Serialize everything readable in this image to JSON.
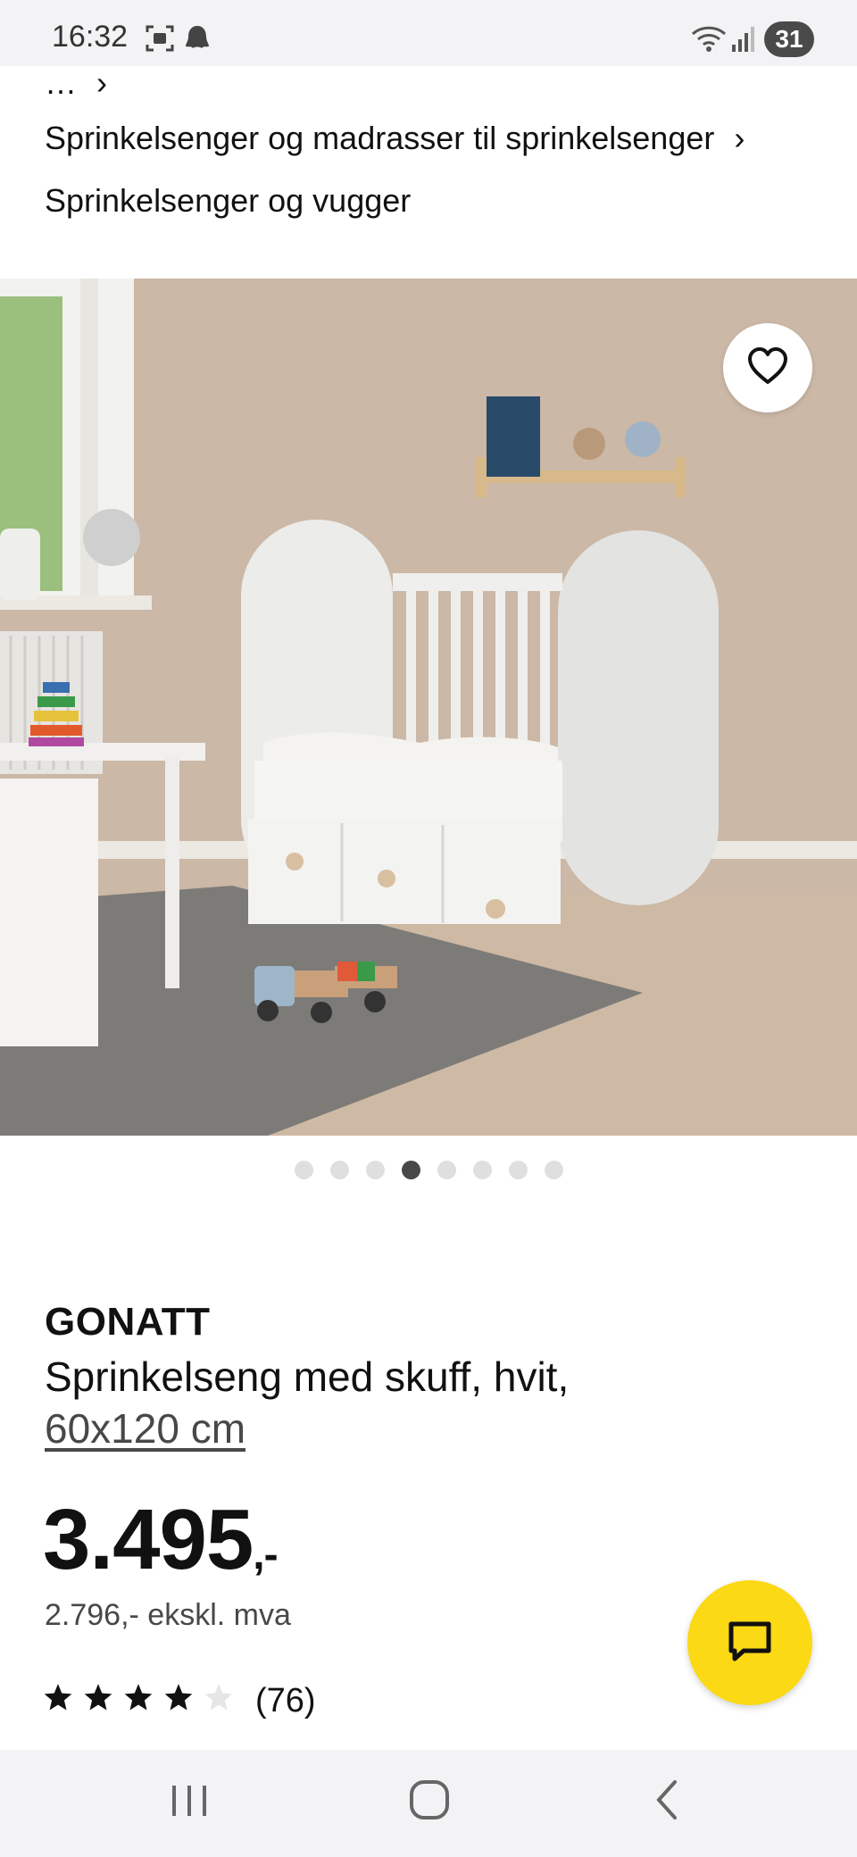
{
  "status_bar": {
    "time": "16:32",
    "battery": "31"
  },
  "breadcrumb": {
    "more": "…",
    "category": "Sprinkelsenger og madrasser til sprinkelsenger",
    "current": "Sprinkelsenger og vugger"
  },
  "carousel": {
    "total": 8,
    "active_index": 3
  },
  "product": {
    "brand": "GONATT",
    "description": "Sprinkelseng med skuff, hvit,",
    "size": "60x120 cm",
    "price": "3.495",
    "price_suffix": ",-",
    "price_ex_vat": "2.796,- ekskl. mva",
    "rating": 4.5,
    "reviews": "(76)"
  },
  "icons": {
    "favorite": "heart-icon",
    "chat": "chat-icon",
    "recents": "recents-icon",
    "home": "home-icon",
    "back": "back-icon"
  },
  "colors": {
    "accent_yellow": "#fbd914",
    "text_dark": "#111111",
    "text_muted": "#484848",
    "dot_active": "#484848",
    "dot_inactive": "#dfdfdf"
  }
}
